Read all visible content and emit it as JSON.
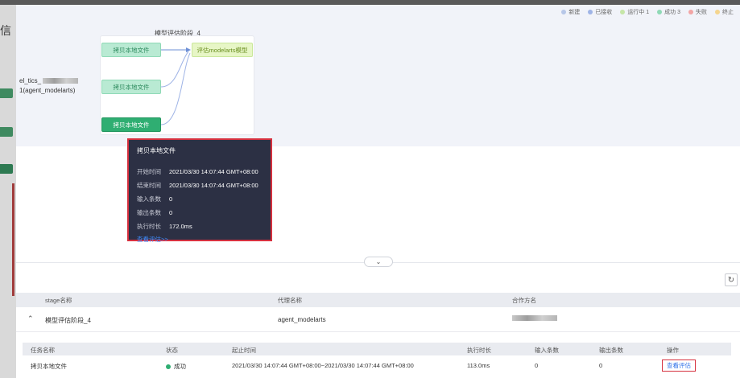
{
  "background": {
    "cut_text": "信"
  },
  "legend": [
    {
      "label": "新建",
      "color": "#b7c7e8"
    },
    {
      "label": "已接收",
      "color": "#9fb4e6"
    },
    {
      "label": "运行中 1",
      "color": "#c6e6a8"
    },
    {
      "label": "成功 3",
      "color": "#8fd9b6"
    },
    {
      "label": "失败",
      "color": "#f2a5a5"
    },
    {
      "label": "终止",
      "color": "#f5d58f"
    }
  ],
  "graph": {
    "stage_title": "模型评估阶段_4",
    "agent_line1": "el_tics_",
    "agent_line2": "1(agent_modelarts)",
    "nodes": [
      {
        "label": "拷贝本地文件"
      },
      {
        "label": "拷贝本地文件"
      },
      {
        "label": "拷贝本地文件"
      },
      {
        "label": "评估modelarts模型"
      }
    ]
  },
  "tooltip": {
    "title": "拷贝本地文件",
    "rows": [
      {
        "key": "开始时间",
        "value": "2021/03/30 14:07:44 GMT+08:00"
      },
      {
        "key": "结束时间",
        "value": "2021/03/30 14:07:44 GMT+08:00"
      },
      {
        "key": "输入条数",
        "value": "0"
      },
      {
        "key": "输出条数",
        "value": "0"
      },
      {
        "key": "执行时长",
        "value": "172.0ms"
      }
    ],
    "link": "查看评估>>"
  },
  "outer_table": {
    "headers": [
      "stage名称",
      "代理名称",
      "合作方名"
    ],
    "row": {
      "stage": "模型评估阶段_4",
      "agent": "agent_modelarts"
    }
  },
  "inner_table": {
    "headers": [
      "任务名称",
      "状态",
      "起止时间",
      "执行时长",
      "输入条数",
      "输出条数",
      "操作"
    ],
    "row": {
      "name": "拷贝本地文件",
      "status": "成功",
      "time_range": "2021/03/30 14:07:44 GMT+08:00~2021/03/30 14:07:44 GMT+08:00",
      "duration": "113.0ms",
      "input": "0",
      "output": "0",
      "action": "查看评估"
    }
  }
}
